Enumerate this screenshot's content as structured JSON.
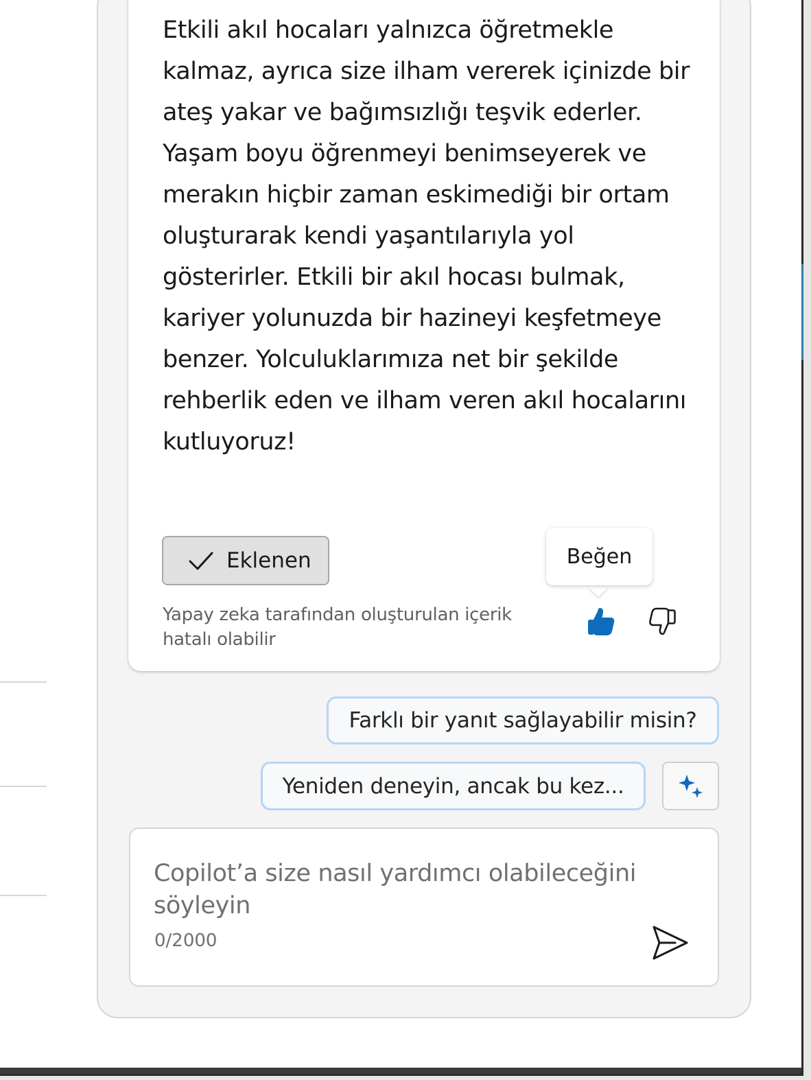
{
  "response": {
    "text": "Etkili akıl hocaları yalnızca öğretmekle kalmaz, ayrıca size ilham vererek içinizde bir ateş yakar ve bağımsızlığı teşvik ederler. Yaşam boyu öğrenmeyi benimseyerek ve merakın hiçbir zaman eskimediği bir ortam oluşturarak kendi yaşantılarıyla yol gösterirler. Etkili bir akıl hocası bulmak, kariyer yolunuzda bir hazineyi keşfetmeye benzer. Yolculuklarımıza net bir şekilde rehberlik eden ve ilham veren akıl hocalarını kutluyoruz!",
    "added_button_label": "Eklenen",
    "disclaimer": "Yapay zeka tarafından oluşturulan içerik hatalı olabilir",
    "tooltip": "Beğen"
  },
  "suggestions": [
    "Farklı bir yanıt sağlayabilir misin?",
    "Yeniden deneyin, ancak bu kez..."
  ],
  "composer": {
    "placeholder": "Copilot’a size nasıl yardımcı olabileceğini söyleyin",
    "char_count": "0/2000"
  },
  "colors": {
    "accent": "#0f6cbd",
    "suggestion_border": "#b5d5f5"
  }
}
